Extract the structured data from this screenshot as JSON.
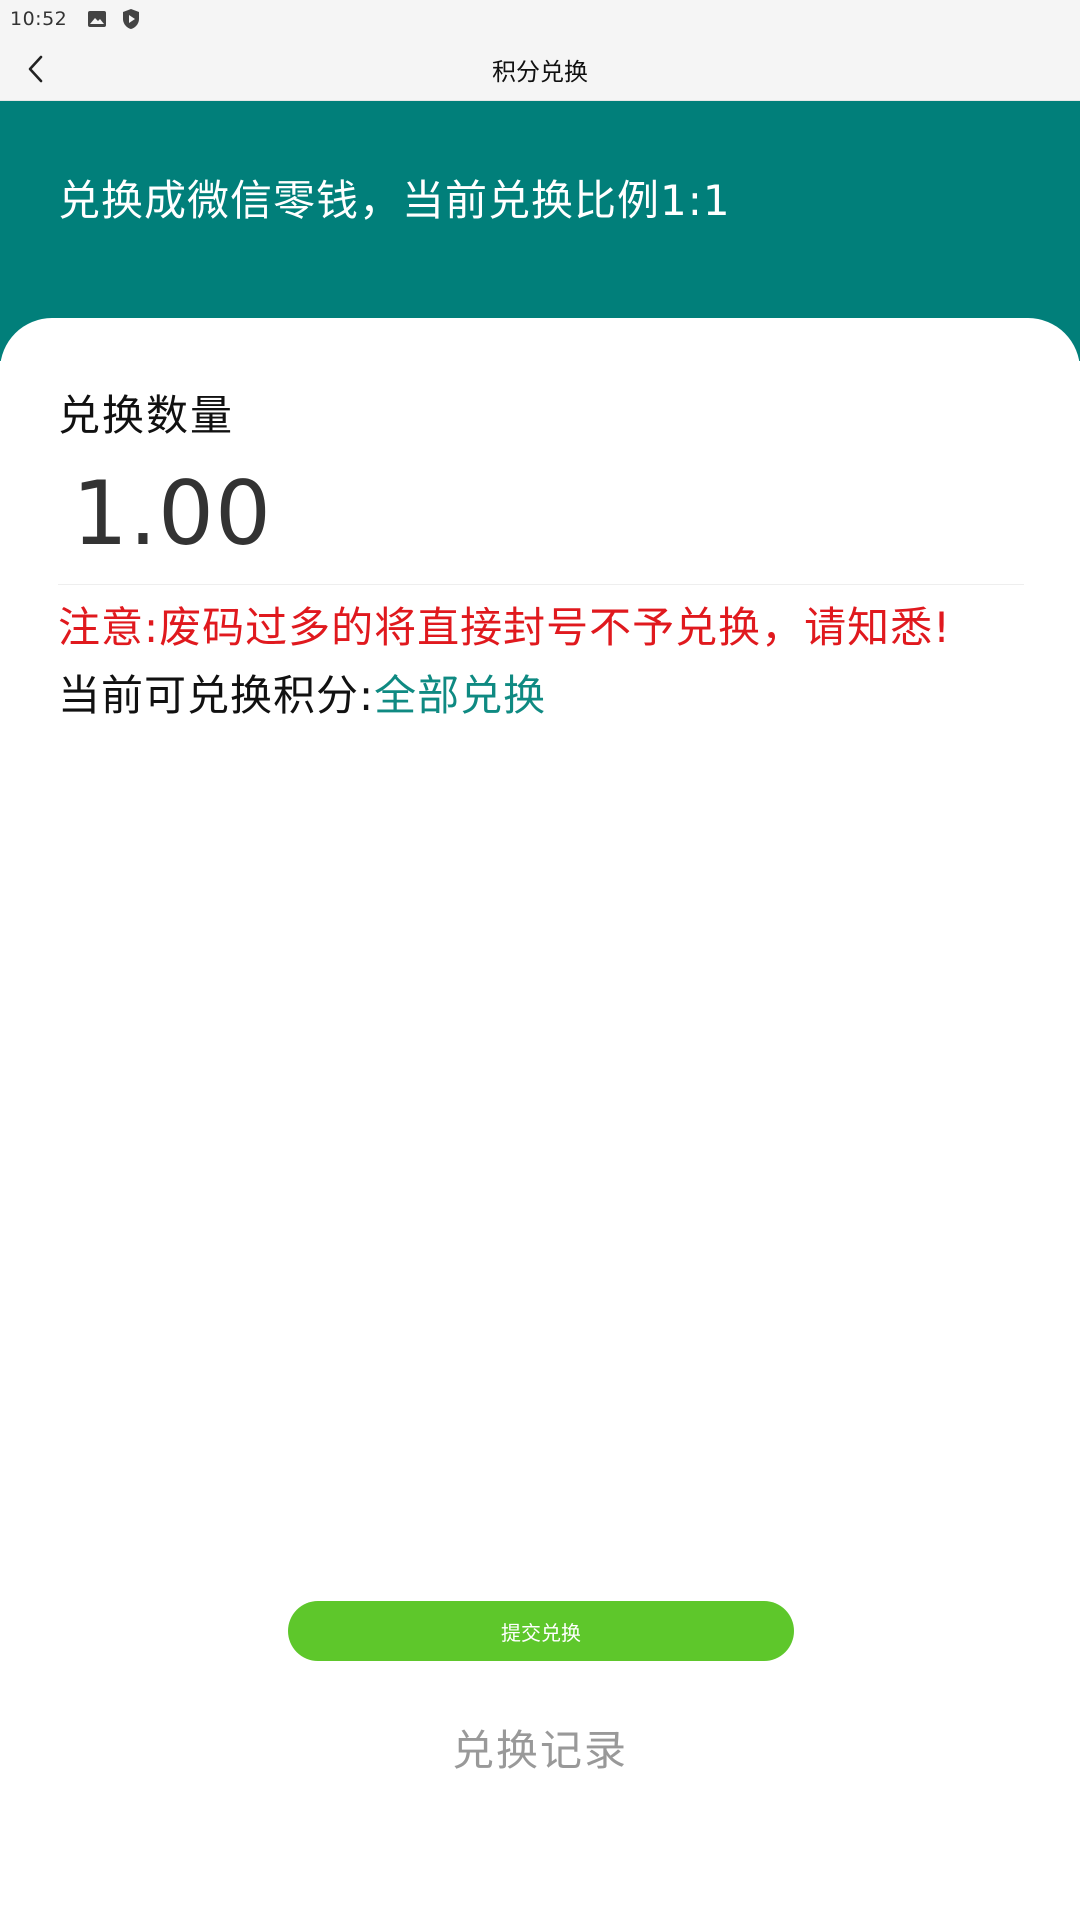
{
  "status_bar": {
    "time": "10:52",
    "icons": [
      "image-icon",
      "shield-play-icon"
    ]
  },
  "nav": {
    "title": "积分兑换",
    "back_icon": "chevron-left-icon"
  },
  "banner": {
    "text": "兑换成微信零钱，当前兑换比例1:1",
    "color": "#017f7a"
  },
  "form": {
    "amount_label": "兑换数量",
    "amount_value": "1.00",
    "warning": "注意:废码过多的将直接封号不予兑换，请知悉!",
    "points_label": "当前可兑换积分:",
    "exchange_all": "全部兑换"
  },
  "actions": {
    "submit_label": "提交兑换",
    "submit_color": "#5ec72b",
    "history_label": "兑换记录"
  }
}
